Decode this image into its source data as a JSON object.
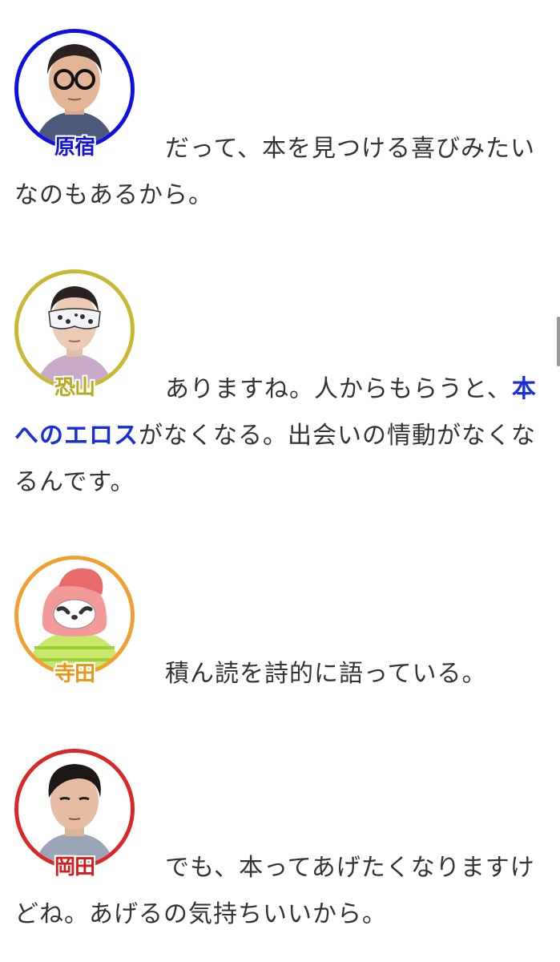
{
  "entries": [
    {
      "speaker": "原宿",
      "ring_color": "#1010e0",
      "name_color": "#1515d8",
      "avatar_icon": "man-with-glasses-portrait",
      "text_before": "だって、本を見つける喜びみたいなのもあるから。",
      "link_text": "",
      "text_after": ""
    },
    {
      "speaker": "恐山",
      "ring_color": "#c8b832",
      "name_color": "#b8a820",
      "avatar_icon": "masked-man-portrait",
      "text_before": "ありますね。人からもらうと、",
      "link_text": "本へのエロス",
      "text_after": "がなくなる。出会いの情動がなくなるんです。"
    },
    {
      "speaker": "寺田",
      "ring_color": "#f0a030",
      "name_color": "#e8951a",
      "avatar_icon": "sloth-character-icon",
      "text_before": "積ん読を詩的に語っている。",
      "link_text": "",
      "text_after": ""
    },
    {
      "speaker": "岡田",
      "ring_color": "#d82828",
      "name_color": "#d01e1e",
      "avatar_icon": "man-portrait",
      "text_before": "でも、本ってあげたくなりますけどね。あげるの気持ちいいから。",
      "link_text": "",
      "text_after": ""
    }
  ]
}
